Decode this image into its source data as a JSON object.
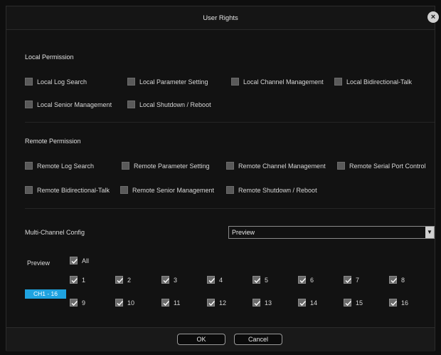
{
  "dialog": {
    "title": "User Rights",
    "close_icon": "close-icon"
  },
  "local": {
    "title": "Local Permission",
    "items": [
      {
        "label": "Local Log Search"
      },
      {
        "label": "Local Parameter Setting"
      },
      {
        "label": "Local Channel Management"
      },
      {
        "label": "Local Bidirectional-Talk"
      },
      {
        "label": "Local Senior Management"
      },
      {
        "label": "Local Shutdown / Reboot"
      }
    ]
  },
  "remote": {
    "title": "Remote Permission",
    "items": [
      {
        "label": "Remote Log Search"
      },
      {
        "label": "Remote Parameter Setting"
      },
      {
        "label": "Remote Channel Management"
      },
      {
        "label": "Remote Serial Port Control"
      },
      {
        "label": "Remote Bidirectional-Talk"
      },
      {
        "label": "Remote Senior Management"
      },
      {
        "label": "Remote Shutdown / Reboot"
      }
    ]
  },
  "multi": {
    "label": "Multi-Channel Config",
    "selected": "Preview",
    "preview_label": "Preview",
    "all_label": "All",
    "group_label": "CH1 - 16",
    "channels": [
      "1",
      "2",
      "3",
      "4",
      "5",
      "6",
      "7",
      "8",
      "9",
      "10",
      "11",
      "12",
      "13",
      "14",
      "15",
      "16"
    ]
  },
  "footer": {
    "ok": "OK",
    "cancel": "Cancel"
  },
  "colors": {
    "accent": "#1fa3e0",
    "background": "#121212"
  }
}
